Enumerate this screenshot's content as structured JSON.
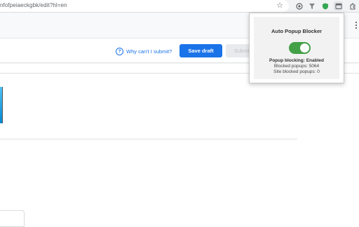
{
  "browser": {
    "url": "nfofpeiaeckgbk/edit?hl=en",
    "icons": [
      "star-icon",
      "extension-shield-icon",
      "extension-filter-icon",
      "extension-vpn-icon",
      "auto-popup-blocker-icon",
      "extensions-puzzle-icon"
    ]
  },
  "action_bar": {
    "why_link": "Why can't I submit?",
    "save_label": "Save draft",
    "submit_label": "Submit"
  },
  "popup": {
    "title": "Auto Popup Blocker",
    "toggle_on": true,
    "status": "Popup blocking: Enabled",
    "blocked": "Blocked popups: 5064",
    "site_blocked": "Site blocked popups: 0"
  },
  "colors": {
    "primary": "#1a73e8",
    "toggle": "#43a047",
    "popup_bg": "#f2f2f2"
  }
}
